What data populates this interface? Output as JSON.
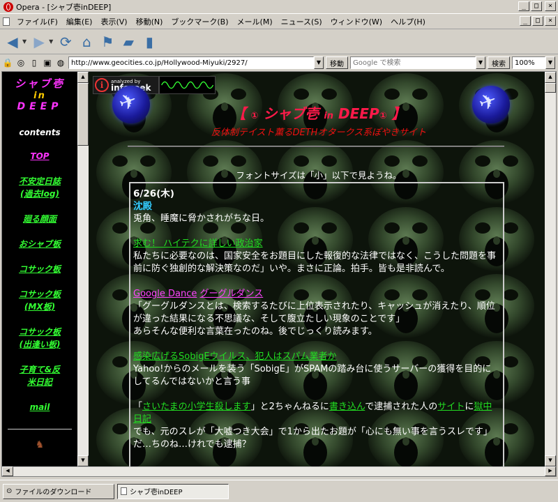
{
  "window": {
    "title": "Opera - [シャブ壱inDEEP]",
    "buttons": [
      "_",
      "□",
      "×"
    ]
  },
  "menu": {
    "items": [
      "ファイル(F)",
      "編集(E)",
      "表示(V)",
      "移動(N)",
      "ブックマーク(B)",
      "メール(M)",
      "ニュース(S)",
      "ウィンドウ(W)",
      "ヘルプ(H)"
    ],
    "mdi_buttons": [
      "_",
      "□",
      "×"
    ]
  },
  "toolbar": {
    "icons": [
      "back-icon",
      "forward-icon",
      "reload-icon",
      "home-icon",
      "hotlist-icon",
      "print-icon",
      "document-icon"
    ]
  },
  "address": {
    "url": "http://www.geocities.co.jp/Hollywood-Miyuki/2927/",
    "go_label": "移動",
    "search_placeholder": "Google で検索",
    "search_label": "検索",
    "zoom": "100%"
  },
  "sidebar": {
    "logo_line1": "シャブ壱",
    "logo_line2": "in",
    "logo_line3": "DEEP",
    "contents_label": "contents",
    "links": [
      {
        "label": "TOP",
        "style": "top"
      },
      {
        "label": "不安定日誌\n(過去log)",
        "style": "green"
      },
      {
        "label": "廻る顔面",
        "style": "green"
      },
      {
        "label": "おシャブ板",
        "style": "green"
      },
      {
        "label": "コサック板",
        "style": "green"
      },
      {
        "label": "コサック板\n(MX板)",
        "style": "green"
      },
      {
        "label": "コサック板\n(出逢い板)",
        "style": "green"
      },
      {
        "label": "子育て&反\n米日記",
        "style": "green"
      },
      {
        "label": "mail",
        "style": "green"
      }
    ]
  },
  "header": {
    "infoseek_small": "analyzed by",
    "infoseek_brand": "infoseek",
    "title_open": "【",
    "title_symbol": "①",
    "title_main": "シャブ壱",
    "title_in": "in",
    "title_deep": "DEEP",
    "title_close": "】",
    "subtitle": "反体制テイスト薫るDETHオタークス系ぽやきサイト",
    "font_note": "フォントサイズは「小」以下で見ようね。"
  },
  "post": {
    "date": "6/26(木)",
    "subject": "沈殿",
    "intro": "兎角、睡魔に脅かされがちな日。",
    "item1_link": "求む！ ハイテクに詳しい政治家",
    "item1_text": "私たちに必要なのは、国家安全をお題目にした報復的な法律ではなく、こうした問題を事前に防ぐ独創的な解決策なのだ」いや。まさに正論。拍手。皆も是非読んで。",
    "item2_link_a": "Google Dance",
    "item2_link_b": "グーグルダンス",
    "item2_text1": "「グーグルダンスとは、検索するたびに上位表示されたり、キャッシュが消えたり、順位が違った結果になる不思議な、そして腹立たしい現象のことです」",
    "item2_text2": "あらそんな便利な言葉在ったのね。後でじっくり読みます。",
    "item3_link": "感染広げるSobigEウイルス、犯人はスパム業者か",
    "item3_text": "Yahoo!からのメールを装う「SobigE」がSPAMの踏み台に使うサーバーの獲得を目的にしてるんではないかと言う事",
    "item4_pre": "「",
    "item4_link1": "さいたまの小学生殺します",
    "item4_mid1": "」と2ちゃんねるに",
    "item4_link2": "書き込ん",
    "item4_mid2": "で逮捕された人の",
    "item4_link3": "サイト",
    "item4_mid3": "に",
    "item4_link4": "獄中日記",
    "item4_text": "でも、元のスレが「大嘘つき大会」で1から出たお題が「心にも無い事を言うスレです」だ…ちのね…けれでも逮捕？"
  },
  "statusbar": {
    "tabs": [
      {
        "label": "ファイルのダウンロード",
        "active": false
      },
      {
        "label": "シャブ壱inDEEP",
        "active": true
      }
    ]
  },
  "colors": {
    "chrome": "#d4d0c8",
    "title_red": "#ff1a4a",
    "link_green": "#22dd22",
    "link_pink": "#ff44ff",
    "subject_cyan": "#33ccff"
  }
}
